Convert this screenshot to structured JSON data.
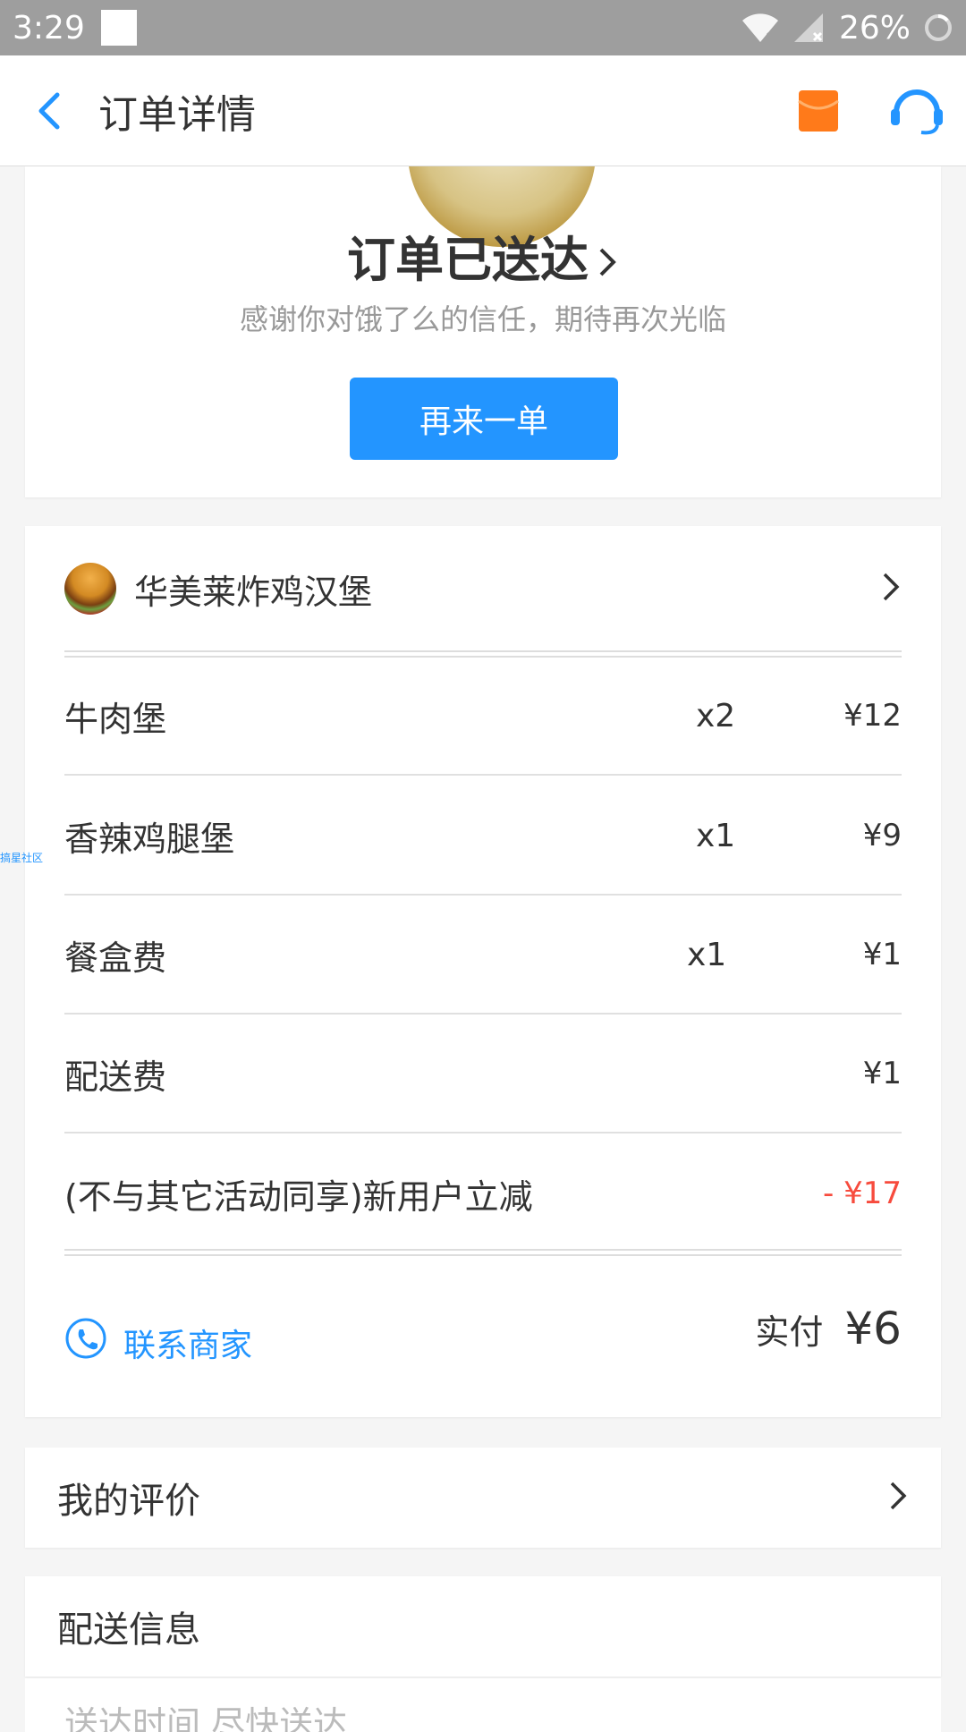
{
  "status_bar": {
    "time": "3:29",
    "battery": "26%"
  },
  "app_bar": {
    "title": "订单详情"
  },
  "order_status": {
    "title": "订单已送达",
    "subtitle": "感谢你对饿了么的信任，期待再次光临",
    "reorder_label": "再来一单"
  },
  "shop": {
    "name": "华美莱炸鸡汉堡"
  },
  "items": [
    {
      "name": "牛肉堡",
      "qty": "x2",
      "price": "¥12"
    },
    {
      "name": "香辣鸡腿堡",
      "qty": "x1",
      "price": "¥9"
    },
    {
      "name": "餐盒费",
      "qty": "x1",
      "price": "¥1"
    },
    {
      "name": "配送费",
      "qty": "",
      "price": "¥1"
    },
    {
      "name": "(不与其它活动同享)新用户立减",
      "qty": "",
      "price": "- ¥17"
    }
  ],
  "footer": {
    "contact_label": "联系商家",
    "paid_label": "实付",
    "paid_amount": "¥6"
  },
  "review": {
    "label": "我的评价"
  },
  "delivery": {
    "label": "配送信息",
    "partial_text": "送达时间 尽快送达"
  },
  "watermark": "搞星社区",
  "colors": {
    "accent": "#2395ff",
    "discount": "#f74b3d",
    "cart": "#ff7a1a"
  }
}
